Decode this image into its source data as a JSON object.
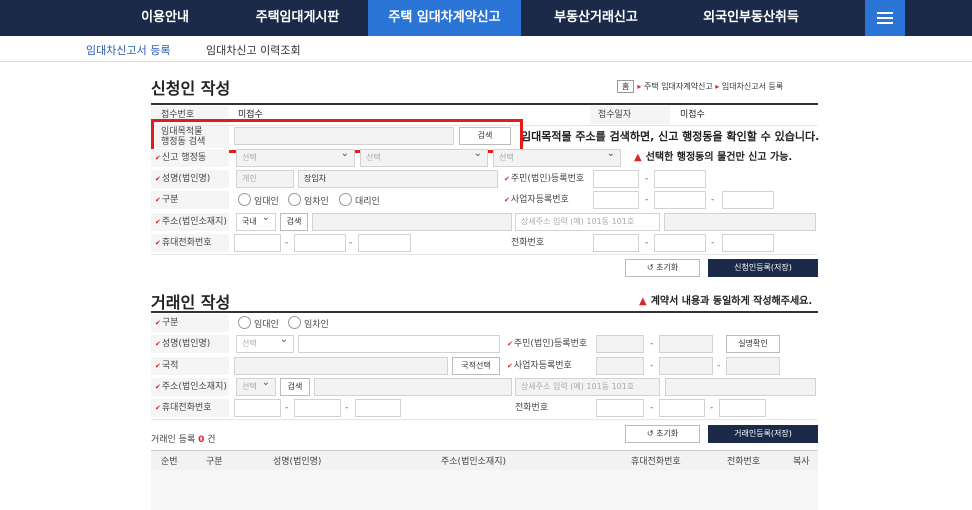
{
  "nav": {
    "items": [
      "이용안내",
      "주택임대게시판",
      "주택 임대차계약신고",
      "부동산거래신고",
      "외국인부동산취득"
    ],
    "active": 2,
    "menu_icon": "hamburger-icon"
  },
  "subnav": {
    "items": [
      "임대차신고서 등록",
      "임대차신고 이력조회"
    ],
    "active": 0
  },
  "breadcrumb": {
    "home": "홈",
    "path1": "주택 임대자계약신고",
    "path2": "임대차신고서 등록"
  },
  "applicant": {
    "title": "신청인 작성",
    "receipt_no_label": "접수번호",
    "receipt_no_value": "미접수",
    "receipt_date_label": "접수일자",
    "receipt_date_value": "미접수",
    "rental_search_label1": "임대목적물",
    "rental_search_label2": "행정동 검색",
    "search_button": "검색",
    "search_hint": "임대목적물 주소를 검색하면, 신고 행정동을 확인할 수 있습니다.",
    "admin_label": "신고 행정동",
    "select_placeholder": "선택",
    "admin_warning": "선택한 행정동의 물건만 신고 가능.",
    "name_label": "성명(법인명)",
    "name_type": "개인",
    "name_value": "장임차",
    "id_label": "주민(법인)등록번호",
    "type_label": "구분",
    "radio_lessor": "임대인",
    "radio_lessee": "임차인",
    "radio_agent": "대리인",
    "biz_label": "사업자등록번호",
    "addr_label": "주소(법인소재지)",
    "addr_country": "국내",
    "addr_search": "검색",
    "addr_detail_placeholder": "상세주소 입력 (예) 101동 101호",
    "mobile_label": "휴대전화번호",
    "phone_label": "전화번호",
    "reset_button": "초기화",
    "register_button": "신청인등록(저장)"
  },
  "counterparty": {
    "title": "거래인 작성",
    "warning": "계약서 내용과 동일하게 작성해주세요.",
    "type_label": "구분",
    "radio_lessor": "임대인",
    "radio_lessee": "임차인",
    "name_label": "성명(법인명)",
    "name_select": "선택",
    "id_label": "주민(법인)등록번호",
    "verify_button": "실명확인",
    "nation_label": "국적",
    "nation_button": "국적선택",
    "biz_label": "사업자등록번호",
    "addr_label": "주소(법인소재지)",
    "addr_select": "선택",
    "addr_search": "검색",
    "addr_detail_placeholder": "상세주소 입력 (예) 101동 101호",
    "mobile_label": "휴대전화번호",
    "phone_label": "전화번호",
    "count_prefix": "거래인 등록",
    "count_value": "0",
    "count_suffix": "건",
    "reset_button": "초기화",
    "register_button": "거래인등록(저장)",
    "table_headers": [
      "순번",
      "구분",
      "성명(법인명)",
      "주소(법인소재지)",
      "휴대전화번호",
      "전화번호",
      "복사"
    ]
  },
  "colors": {
    "nav_bg": "#1c2a4a",
    "nav_active": "#2a75d6",
    "required": "#d8262b",
    "highlight_box": "#e21b1b"
  }
}
